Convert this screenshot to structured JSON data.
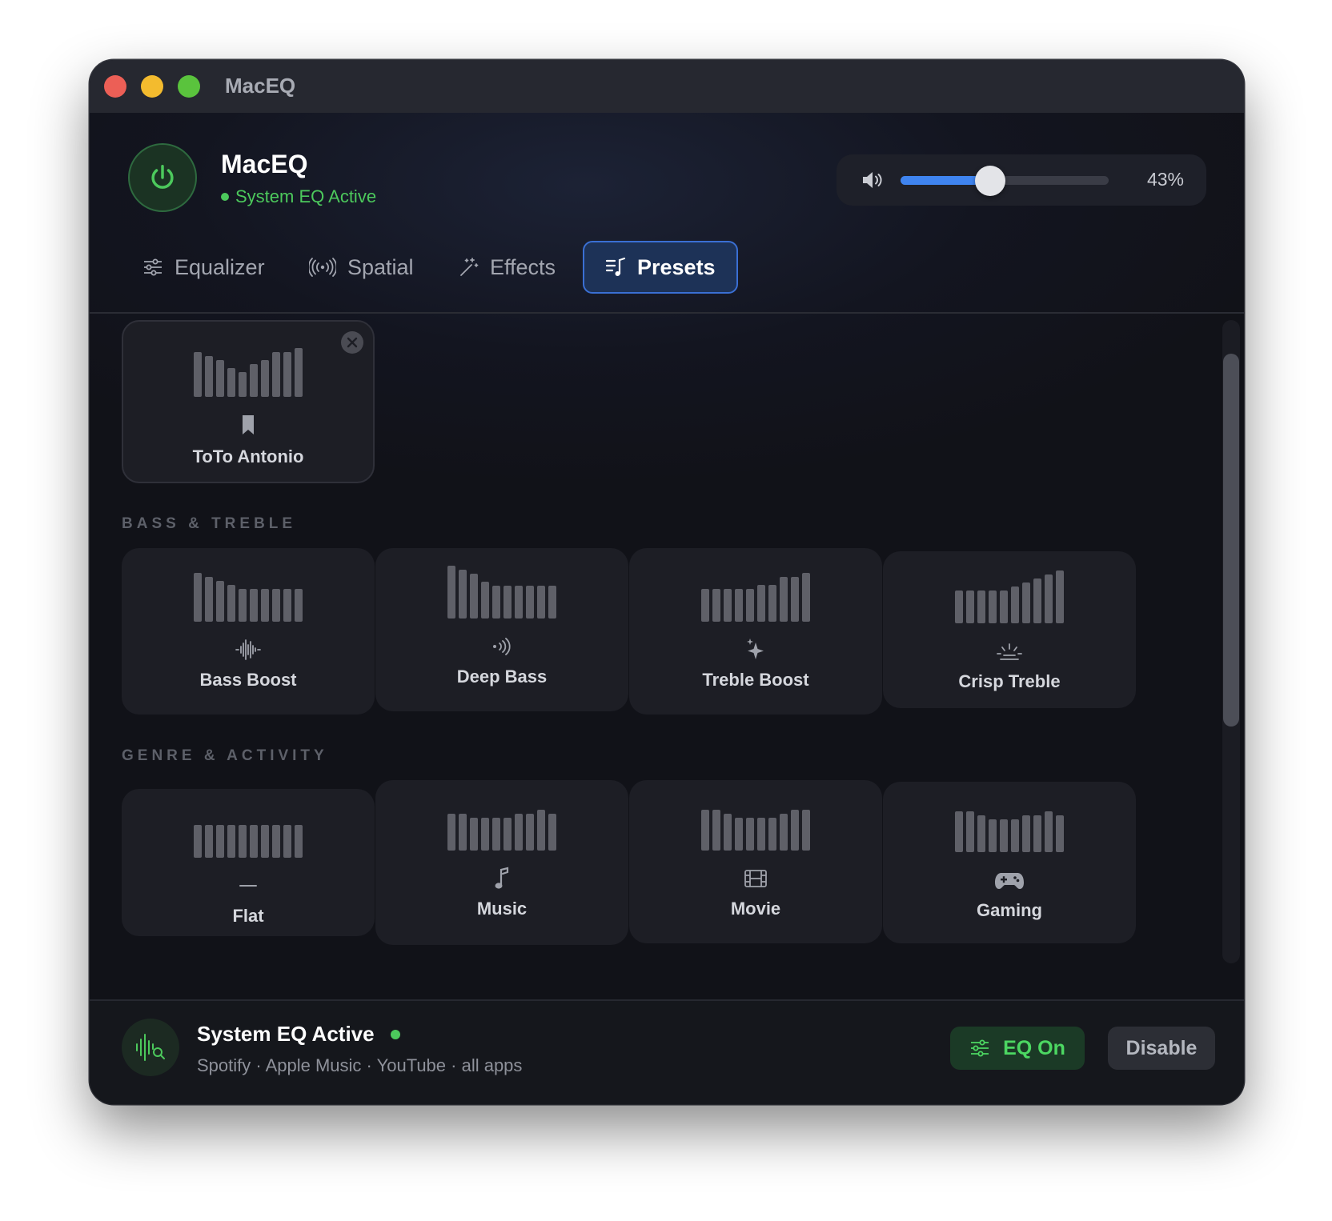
{
  "window": {
    "title": "MacEQ"
  },
  "header": {
    "app_name": "MacEQ",
    "status": "System EQ Active",
    "volume_label": "43%",
    "volume_level": 0.43
  },
  "tabs": [
    {
      "label": "Equalizer",
      "icon": "sliders-icon",
      "active": false
    },
    {
      "label": "Spatial",
      "icon": "spatial-waves-icon",
      "active": false
    },
    {
      "label": "Effects",
      "icon": "magic-wand-icon",
      "active": false
    },
    {
      "label": "Presets",
      "icon": "music-list-icon",
      "active": true
    }
  ],
  "custom_presets": [
    {
      "label": "ToTo Antonio",
      "icon": "bookmark-icon",
      "levels": [
        8,
        7,
        6,
        4,
        3,
        5,
        6,
        8,
        8,
        9
      ]
    }
  ],
  "sections": [
    {
      "title": "BASS & TREBLE",
      "presets": [
        {
          "label": "Bass Boost",
          "icon": "waveform-icon",
          "levels": [
            9,
            8,
            7,
            6,
            5,
            5,
            5,
            5,
            5,
            5
          ]
        },
        {
          "label": "Deep Bass",
          "icon": "sound-waves-icon",
          "levels": [
            10,
            9,
            8,
            6,
            5,
            5,
            5,
            5,
            5,
            5
          ]
        },
        {
          "label": "Treble Boost",
          "icon": "sparkle-icon",
          "levels": [
            5,
            5,
            5,
            5,
            5,
            6,
            6,
            8,
            8,
            9
          ]
        },
        {
          "label": "Crisp Treble",
          "icon": "sun-horizon-icon",
          "levels": [
            5,
            5,
            5,
            5,
            5,
            6,
            7,
            8,
            9,
            10
          ]
        }
      ]
    },
    {
      "title": "GENRE & ACTIVITY",
      "presets": [
        {
          "label": "Flat",
          "icon": "flat-line-icon",
          "levels": [
            5,
            5,
            5,
            5,
            5,
            5,
            5,
            5,
            5,
            5
          ]
        },
        {
          "label": "Music",
          "icon": "music-note-icon",
          "levels": [
            6,
            6,
            5,
            5,
            5,
            5,
            6,
            6,
            7,
            6
          ]
        },
        {
          "label": "Movie",
          "icon": "film-icon",
          "levels": [
            7,
            7,
            6,
            5,
            5,
            5,
            5,
            6,
            7,
            7
          ]
        },
        {
          "label": "Gaming",
          "icon": "gamepad-icon",
          "levels": [
            7,
            7,
            6,
            5,
            5,
            5,
            6,
            6,
            7,
            6
          ]
        }
      ]
    }
  ],
  "footer": {
    "title": "System EQ Active",
    "subtitle": "Spotify · Apple Music · YouTube · all apps",
    "eq_on_label": "EQ On",
    "disable_label": "Disable"
  },
  "colors": {
    "accent_green": "#4cc95c",
    "accent_blue": "#3f84f0",
    "tab_active_bg": "#1d3257",
    "close": "#ec5f56",
    "minimize": "#f3bb2e",
    "maximize": "#5ac33d"
  }
}
